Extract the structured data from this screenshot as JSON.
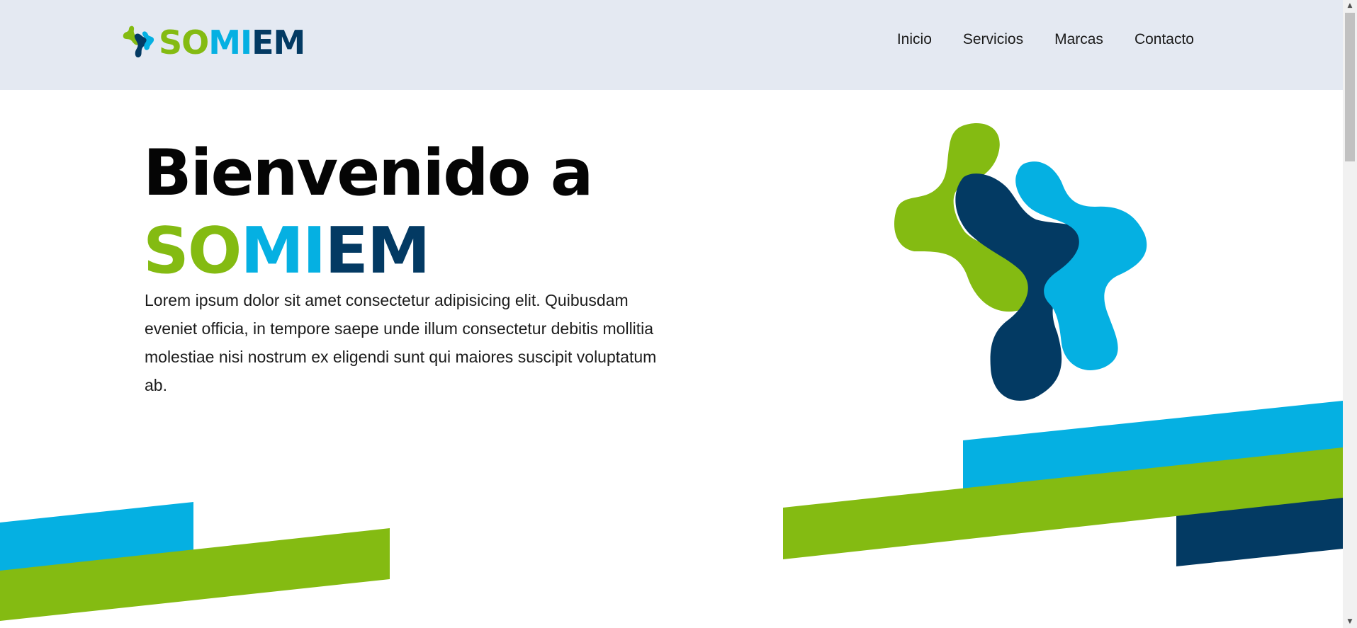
{
  "brand": {
    "segments": [
      {
        "text": "SO",
        "color": "#84bb12"
      },
      {
        "text": "MI",
        "color": "#05b0e2"
      },
      {
        "text": "EM",
        "color": "#033a63"
      }
    ]
  },
  "nav": {
    "items": [
      "Inicio",
      "Servicios",
      "Marcas",
      "Contacto"
    ]
  },
  "hero": {
    "title_line1": "Bienvenido a",
    "title_brand": {
      "so": "SO",
      "mi": "MI",
      "em": "EM"
    },
    "paragraph": "Lorem ipsum dolor sit amet consectetur adipisicing elit. Quibusdam eveniet officia, in tempore saepe unde illum consectetur debitis mollitia molestiae nisi nostrum ex eligendi sunt qui maiores suscipit voluptatum ab."
  },
  "icons": {
    "logo_mark": "puzzle-cross-logo-icon",
    "hero_graphic": "puzzle-cross-logo-icon",
    "scroll_up": "triangle-up-icon",
    "scroll_down": "triangle-down-icon"
  },
  "colors": {
    "header_bg": "#e4e9f2",
    "green": "#84bb12",
    "blue": "#05b0e2",
    "navy": "#033a63"
  }
}
